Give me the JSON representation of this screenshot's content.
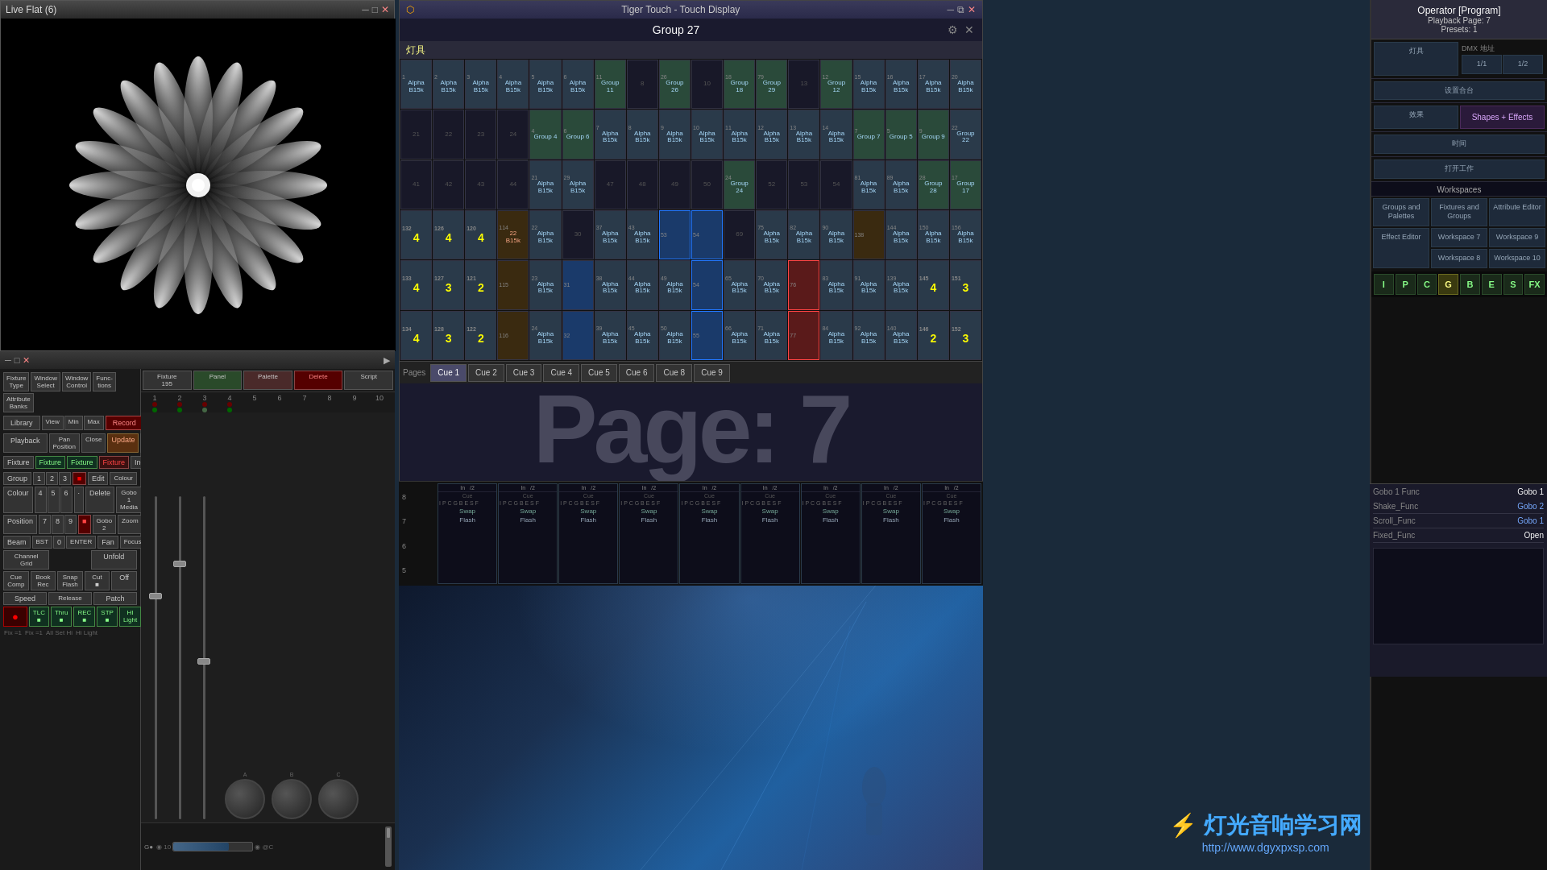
{
  "app": {
    "live_flat_title": "Live Flat (6)",
    "touch_display_title": "Tiger Touch - Touch Display",
    "group_title": "Group 27",
    "fixture_label": "灯具"
  },
  "operator": {
    "label": "Operator [Program]",
    "playback_page": "Playback Page: 7",
    "presets": "Presets: 1"
  },
  "right_panel": {
    "lights_label": "灯具",
    "dmx_label": "DMX 地址",
    "page_label": "1/1",
    "dmx_page": "1/2",
    "setup_label": "设置合台",
    "effects_label": "效果",
    "shapes_effects": "Shapes + Effects",
    "time_label": "时间",
    "open_label": "打开工作",
    "workspaces_label": "Workspaces",
    "groups_palettes": "Groups and Palettes",
    "fixtures_groups": "Fixtures and Groups",
    "attribute_editor": "Attribute Editor",
    "effect_editor": "Effect Editor",
    "workspace7": "Workspace 7",
    "workspace8": "Workspace 8",
    "workspace9": "Workspace 9",
    "workspace10": "Workspace 10"
  },
  "gobo": {
    "func_label": "Gobo 1 Func",
    "func_val": "Gobo 1",
    "shake_func": "Shake_Func",
    "shake_val": "Gobo 2",
    "scroll_func": "Scroll_Func",
    "scroll_val": "Gobo 1",
    "fixed_func": "Fixed_Func",
    "fixed_val": "Open"
  },
  "pages": {
    "pages_label": "Pages",
    "cue1": "Cue 1",
    "cue2": "Cue 2",
    "cue3": "Cue 3",
    "cue4": "Cue 4",
    "cue5": "Cue 5",
    "cue6": "Cue 6",
    "cue8": "Cue 8",
    "cue9": "Cue 9"
  },
  "page_number": "Page: 7",
  "letters": [
    "I",
    "P",
    "C",
    "G",
    "B",
    "E",
    "S",
    "FX"
  ],
  "active_letter": "G",
  "watermark": {
    "logo": "⚡ 灯光音响学习网",
    "url": "http://www.dgyxpxsp.com"
  },
  "grid_cells": [
    {
      "num": "1",
      "name": "Alpha B15k",
      "type": "normal"
    },
    {
      "num": "2",
      "name": "Alpha B15k",
      "type": "normal"
    },
    {
      "num": "3",
      "name": "Alpha B15k",
      "type": "normal"
    },
    {
      "num": "4",
      "name": "Alpha B15k",
      "type": "normal"
    },
    {
      "num": "5",
      "name": "Alpha B15k",
      "type": "normal"
    },
    {
      "num": "6",
      "name": "Alpha B15k",
      "type": "normal"
    },
    {
      "num": "11",
      "name": "Group 11",
      "type": "group"
    },
    {
      "num": "",
      "name": "8",
      "type": "empty"
    },
    {
      "num": "26",
      "name": "Group 26",
      "type": "group"
    },
    {
      "num": "",
      "name": "10",
      "type": "empty"
    },
    {
      "num": "18",
      "name": "Group 18",
      "type": "group"
    },
    {
      "num": "79",
      "name": "Group 29",
      "type": "group"
    },
    {
      "num": "",
      "name": "13",
      "type": "empty"
    },
    {
      "num": "12",
      "name": "Group 12",
      "type": "group"
    },
    {
      "num": "15",
      "name": "Alpha B15k",
      "type": "normal"
    },
    {
      "num": "16",
      "name": "Alpha B15k",
      "type": "normal"
    },
    {
      "num": "17",
      "name": "Alpha B15k",
      "type": "normal"
    },
    {
      "num": "20",
      "name": "Alpha B15k",
      "type": "normal"
    }
  ],
  "playback_rows": {
    "row_in": "In",
    "row_out": "/2",
    "fader_labels": [
      "Cue",
      "G",
      "B",
      "E",
      "S"
    ],
    "swap_label": "Swap",
    "flash_label": "Flash"
  }
}
